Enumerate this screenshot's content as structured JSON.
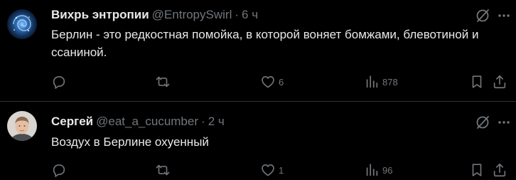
{
  "tweets": [
    {
      "display_name": "Вихрь энтропии",
      "handle": "@EntropySwirl",
      "separator": "·",
      "time": "6 ч",
      "text": "Берлин - это редкостная помойка, в которой воняет бомжами, блевотиной и ссаниной.",
      "actions": {
        "reply_icon": "reply-icon",
        "retweet_icon": "retweet-icon",
        "like_icon": "heart-icon",
        "like_count": "6",
        "views_icon": "views-icon",
        "views_count": "878",
        "bookmark_icon": "bookmark-icon",
        "share_icon": "share-icon"
      }
    },
    {
      "display_name": "Сергей",
      "handle": "@eat_a_cucumber",
      "separator": "·",
      "time": "2 ч",
      "text": "Воздух в Берлине охуенный",
      "actions": {
        "reply_icon": "reply-icon",
        "retweet_icon": "retweet-icon",
        "like_icon": "heart-icon",
        "like_count": "1",
        "views_icon": "views-icon",
        "views_count": "96",
        "bookmark_icon": "bookmark-icon",
        "share_icon": "share-icon"
      }
    }
  ],
  "colors": {
    "background": "#000000",
    "primary_text": "#e7e9ea",
    "secondary_text": "#71767b",
    "separator": "#2f3336"
  }
}
